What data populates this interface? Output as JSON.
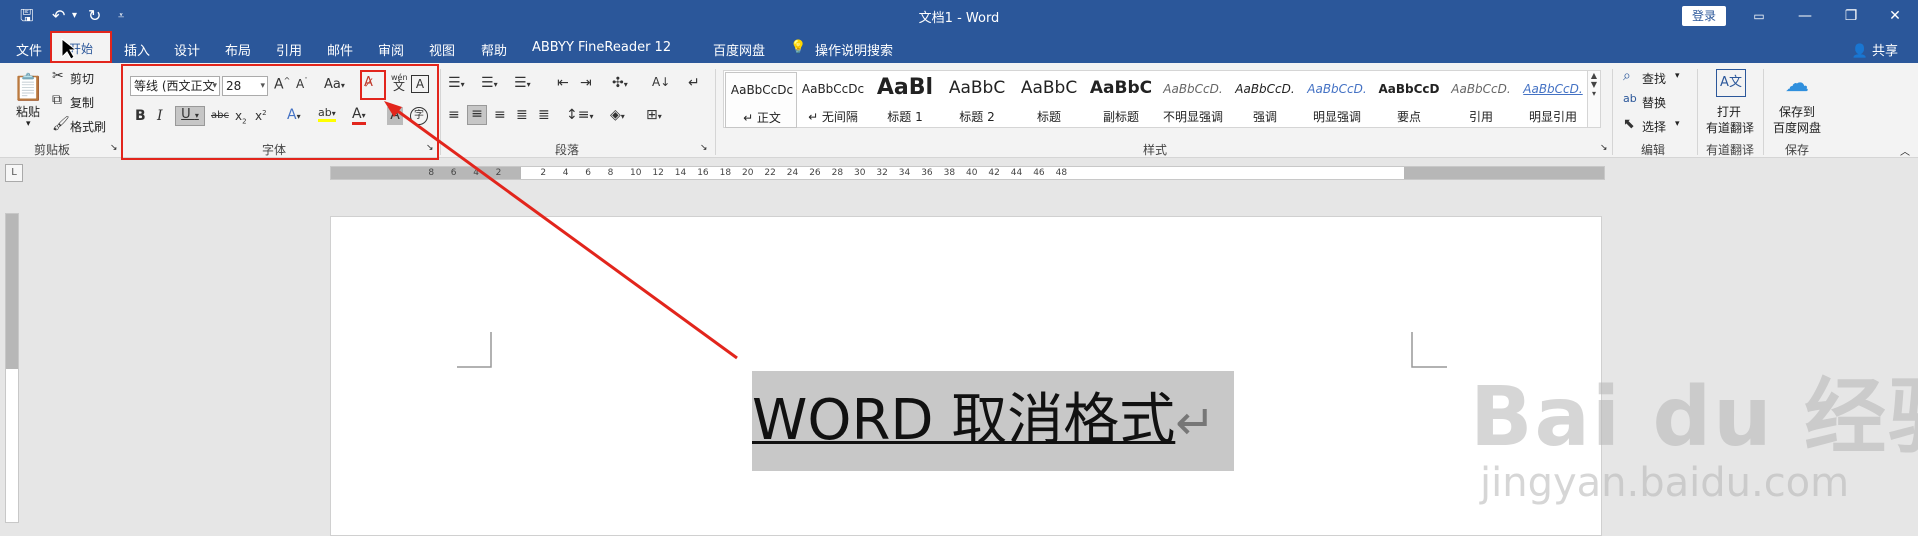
{
  "titlebar": {
    "doc_title": "文档1 - Word",
    "login": "登录",
    "save_icon": "save-icon",
    "undo_icon": "undo-icon",
    "redo_icon": "redo-icon"
  },
  "tabs": [
    "文件",
    "开始",
    "插入",
    "设计",
    "布局",
    "引用",
    "邮件",
    "审阅",
    "视图",
    "帮助",
    "ABBYY FineReader 12",
    "百度网盘",
    "操作说明搜索"
  ],
  "share": "共享",
  "clipboard": {
    "paste": "粘贴",
    "cut": "剪切",
    "copy": "复制",
    "format_painter": "格式刷",
    "label": "剪贴板"
  },
  "font": {
    "name": "等线 (西文正文",
    "size": "28",
    "label": "字体",
    "pinyin": "wén",
    "pinyin_char": "文"
  },
  "paragraph": {
    "label": "段落"
  },
  "styles": {
    "label": "样式",
    "items": [
      {
        "preview": "AaBbCcDc",
        "name": "↵ 正文"
      },
      {
        "preview": "AaBbCcDc",
        "name": "↵ 无间隔"
      },
      {
        "preview": "AaBl",
        "name": "标题 1"
      },
      {
        "preview": "AaBbC",
        "name": "标题 2"
      },
      {
        "preview": "AaBbC",
        "name": "标题"
      },
      {
        "preview": "AaBbC",
        "name": "副标题"
      },
      {
        "preview": "AaBbCcD.",
        "name": "不明显强调"
      },
      {
        "preview": "AaBbCcD.",
        "name": "强调"
      },
      {
        "preview": "AaBbCcD.",
        "name": "明显强调"
      },
      {
        "preview": "AaBbCcD",
        "name": "要点"
      },
      {
        "preview": "AaBbCcD.",
        "name": "引用"
      },
      {
        "preview": "AaBbCcD.",
        "name": "明显引用"
      }
    ]
  },
  "editing": {
    "find": "查找",
    "replace": "替换",
    "select": "选择",
    "label": "编辑"
  },
  "youdao": {
    "line1": "打开",
    "line2": "有道翻译",
    "label": "有道翻译"
  },
  "baidu": {
    "line1": "保存到",
    "line2": "百度网盘",
    "label": "保存"
  },
  "ruler": {
    "left_numbers": [
      "8",
      "6",
      "4",
      "2"
    ],
    "right_numbers": [
      "2",
      "4",
      "6",
      "8",
      "10",
      "12",
      "14",
      "16",
      "18",
      "20",
      "22",
      "24",
      "26",
      "28",
      "30",
      "32",
      "34",
      "36",
      "38",
      "40",
      "42",
      "44",
      "46",
      "48"
    ]
  },
  "document": {
    "text": "WORD 取消格式",
    "para_mark": "↵"
  },
  "watermark": {
    "main": "Bai du 经验",
    "sub": "jingyan.baidu.com"
  },
  "colors": {
    "accent": "#2b579a",
    "highlight_box": "#e2251c"
  }
}
